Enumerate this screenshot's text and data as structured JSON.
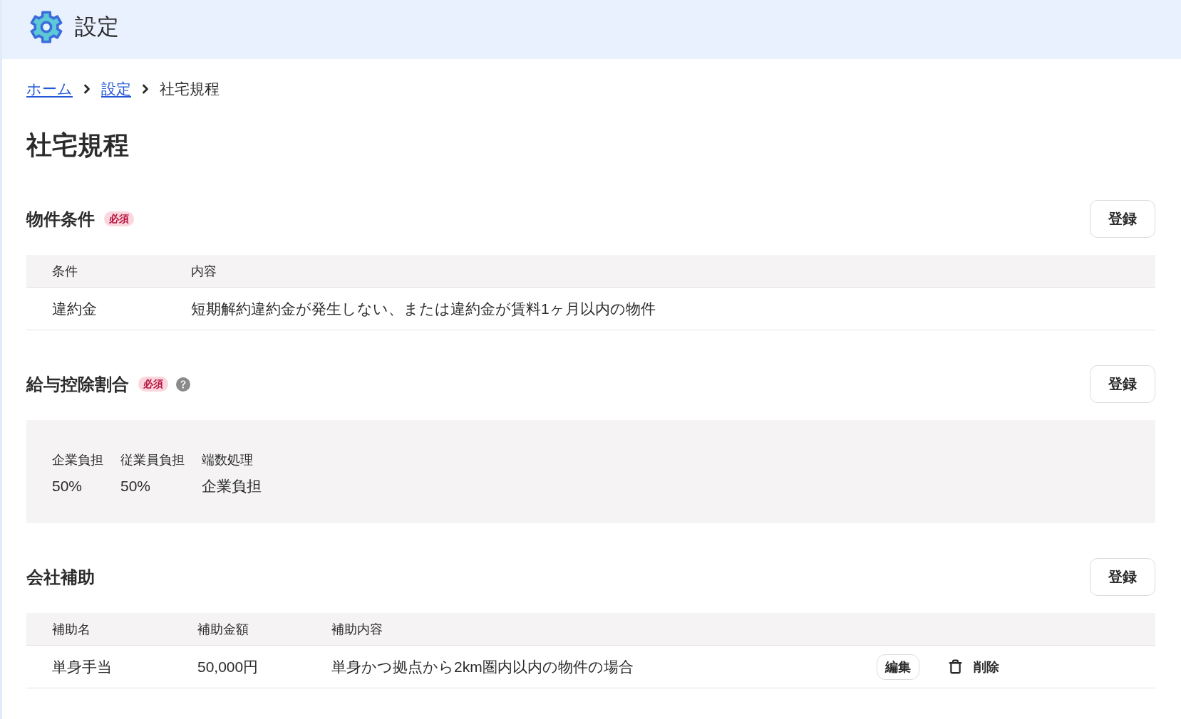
{
  "header": {
    "title": "設定"
  },
  "breadcrumb": [
    {
      "label": "ホーム",
      "kind": "link"
    },
    {
      "label": "設定",
      "kind": "link"
    },
    {
      "label": "社宅規程",
      "kind": "current"
    }
  ],
  "page_title": "社宅規程",
  "sections": [
    {
      "kind": "table",
      "title": "物件条件",
      "badge": "必須",
      "help": false,
      "button": "登録",
      "table": {
        "columns": [
          "条件",
          "内容"
        ],
        "rows": [
          {
            "cells": [
              "違約金",
              "短期解約違約金が発生しない、または違約金が賃料1ヶ月以内の物件"
            ]
          }
        ]
      }
    },
    {
      "kind": "summary",
      "title": "給与控除割合",
      "badge": "必須",
      "help": true,
      "button": "登録",
      "fields": [
        {
          "label": "企業負担",
          "value": "50%"
        },
        {
          "label": "従業員負担",
          "value": "50%"
        },
        {
          "label": "端数処理",
          "value": "企業負担"
        }
      ]
    },
    {
      "kind": "table",
      "title": "会社補助",
      "help": false,
      "button": "登録",
      "table": {
        "columns": [
          "補助名",
          "補助金額",
          "補助内容"
        ],
        "rows": [
          {
            "cells": [
              "単身手当",
              "50,000円",
              "単身かつ拠点から2km圏内以内の物件の場合"
            ],
            "actions": [
              {
                "kind": "edit",
                "label": "編集"
              },
              {
                "kind": "delete",
                "label": "削除"
              }
            ]
          }
        ]
      }
    }
  ]
}
